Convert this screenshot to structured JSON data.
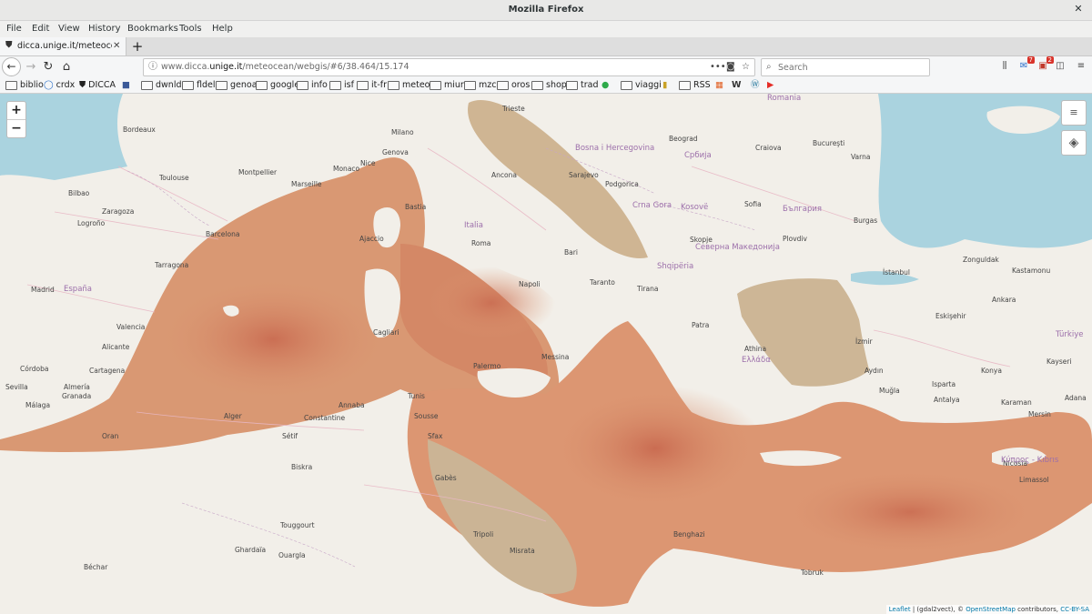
{
  "window": {
    "title": "Mozilla Firefox"
  },
  "menu": [
    "File",
    "Edit",
    "View",
    "History",
    "Bookmarks",
    "Tools",
    "Help"
  ],
  "tab": {
    "label": "dicca.unige.it/meteocean/"
  },
  "url": {
    "scheme": "www.dicca.",
    "host": "unige.it",
    "path": "/meteocean/webgis/#6/38.464/15.174"
  },
  "search": {
    "placeholder": "Search"
  },
  "toolbar": {
    "badge1": "7",
    "badge2": "2"
  },
  "bookmarks": [
    "biblio",
    "crdx",
    "DICCA",
    "dwnld",
    "fldel",
    "genoa",
    "google",
    "info",
    "isf",
    "it-fr",
    "meteo",
    "miur",
    "mzc",
    "oros",
    "shop",
    "trad",
    "viaggi",
    "RSS"
  ],
  "map": {
    "zoom_in": "+",
    "zoom_out": "−",
    "attribution": {
      "leaflet": "Leaflet",
      "src": " | (gdal2vect), © ",
      "osm": "OpenStreetMap",
      "contrib": " contributors, ",
      "license": "CC-BY-SA"
    },
    "colors": {
      "land": "#f2efe9",
      "sea": "#aad3df",
      "field_low": "#cdb696",
      "field_mid": "#dd9a74",
      "field_high": "#cc6f55"
    }
  },
  "places": [
    "Bordeaux",
    "Toulouse",
    "Montpellier",
    "Marseille",
    "Nice",
    "Monaco",
    "Genova",
    "Milano",
    "Trieste",
    "Ancona",
    "Roma",
    "Napoli",
    "Bari",
    "Taranto",
    "Palermo",
    "Messina",
    "Cagliari",
    "Bastia",
    "Ajaccio",
    "Barcelona",
    "Tarragona",
    "Valencia",
    "Alicante",
    "Cartagena",
    "Almería",
    "Málaga",
    "Granada",
    "Madrid",
    "Córdoba",
    "Sevilla",
    "Bilbao",
    "Zaragoza",
    "Logroño",
    "Alger",
    "Oran",
    "Constantine",
    "Annaba",
    "Tunis",
    "Sfax",
    "Gabès",
    "Tripoli",
    "Misrata",
    "Benghazi",
    "Tobruk",
    "Sousse",
    "Sétif",
    "Biskra",
    "Touggourt",
    "Ghardaïa",
    "Ouargla",
    "Béchar",
    "Sofia",
    "Skopje",
    "Tirana",
    "Athina",
    "Patra",
    "İzmir",
    "Antalya",
    "Ankara",
    "İstanbul",
    "Beograd",
    "Sarajevo",
    "Podgorica",
    "Bucureşti",
    "Craiova",
    "Plovdiv",
    "Varna",
    "Burgas",
    "Kayseri",
    "Konya",
    "Aydın",
    "Muğla",
    "Isparta",
    "Eskişehir",
    "Zonguldak",
    "Kastamonu",
    "Karaman",
    "Mersin",
    "Adana",
    "Nicosia",
    "Limassol"
  ],
  "countries": [
    "España",
    "Italia",
    "Ελλάδα",
    "Türkiye",
    "България",
    "Србија",
    "Shqipëria",
    "Северна Македонија",
    "Crna Gora",
    "Bosna i Hercegovina",
    "Romania",
    "Kosovë",
    "Κύπρος - Kıbrıs"
  ]
}
